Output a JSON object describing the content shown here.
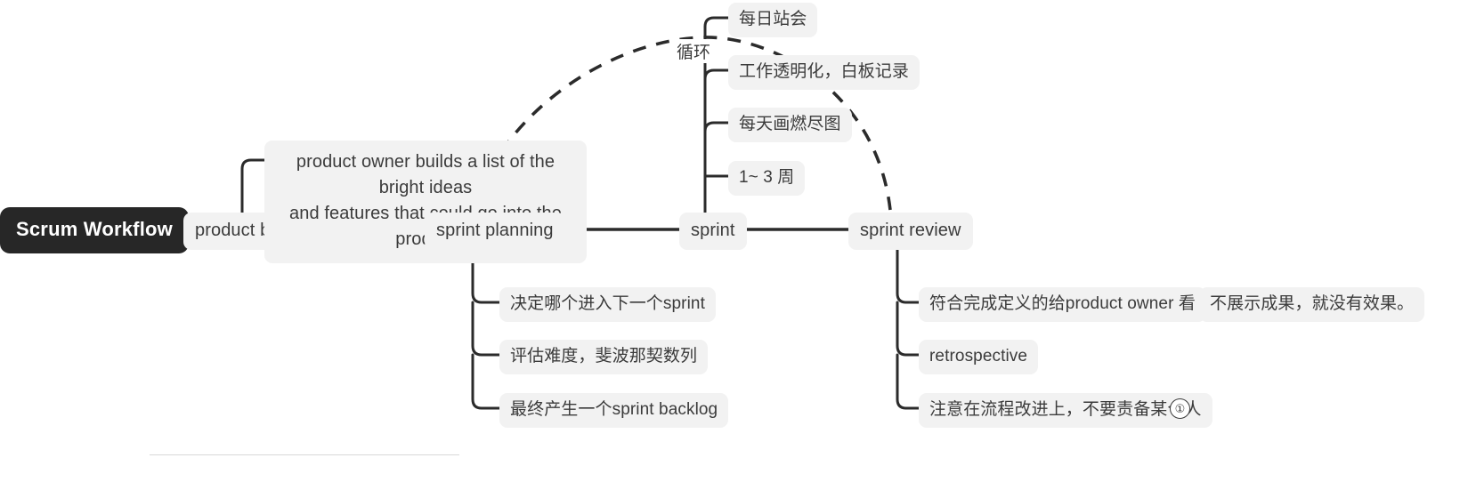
{
  "diagram": {
    "title": "Scrum Workflow",
    "type": "mindmap"
  },
  "root": {
    "label": "Scrum Workflow"
  },
  "loop": {
    "label": "循环"
  },
  "footnote": {
    "marker": "①"
  },
  "colors": {
    "root_background": "#272727",
    "root_text": "#ffffff",
    "node_background": "#f2f2f2",
    "node_text": "#3b3b3b",
    "connector": "#2b2b2b",
    "canvas": "#ffffff"
  },
  "branches": [
    {
      "id": "product-backlog",
      "label": "product backlog",
      "children": [
        {
          "id": "po-builds-list",
          "label": "product owner builds a list of the bright ideas\nand  features that could go into the product"
        }
      ]
    },
    {
      "id": "sprint-planning",
      "label": "sprint planning",
      "children": [
        {
          "id": "decide-next-sprint",
          "label": "决定哪个进入下一个sprint"
        },
        {
          "id": "estimate-difficulty",
          "label": "评估难度，斐波那契数列"
        },
        {
          "id": "produce-sprint-backlog",
          "label": "最终产生一个sprint backlog"
        }
      ]
    },
    {
      "id": "sprint",
      "label": "sprint",
      "children": [
        {
          "id": "daily-standup",
          "label": "每日站会"
        },
        {
          "id": "work-transparency",
          "label": "工作透明化，白板记录"
        },
        {
          "id": "burndown-chart",
          "label": "每天画燃尽图"
        },
        {
          "id": "duration",
          "label": "1~ 3 周"
        }
      ]
    },
    {
      "id": "sprint-review",
      "label": "sprint review",
      "children": [
        {
          "id": "show-to-product-owner",
          "label": "符合完成定义的给product owner 看",
          "children": [
            {
              "id": "no-demo-no-effect",
              "label": "不展示成果，就没有效果。"
            }
          ]
        },
        {
          "id": "retrospective",
          "label": "retrospective"
        },
        {
          "id": "focus-on-process",
          "label": "注意在流程改进上，不要责备某个人"
        }
      ]
    }
  ]
}
